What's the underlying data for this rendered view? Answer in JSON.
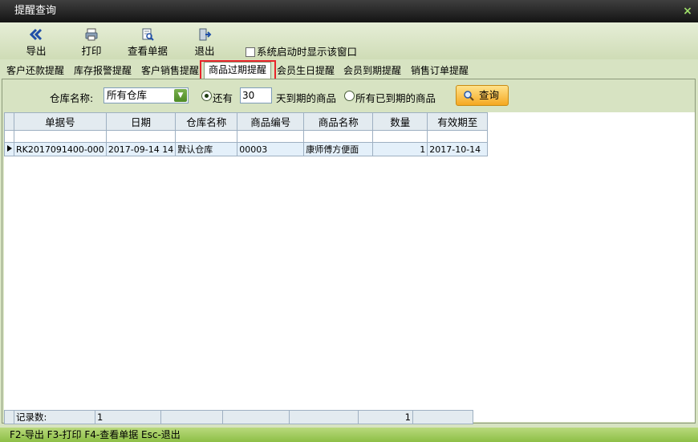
{
  "window": {
    "title": "提醒查询"
  },
  "toolbar": {
    "export": "导出",
    "print": "打印",
    "view_doc": "查看单据",
    "exit": "退出",
    "startup_checkbox": "系统启动时显示该窗口"
  },
  "tabs": [
    "客户还款提醒",
    "库存报警提醒",
    "客户销售提醒",
    "商品过期提醒",
    "会员生日提醒",
    "会员到期提醒",
    "销售订单提醒"
  ],
  "active_tab": "商品过期提醒",
  "filter": {
    "warehouse_label": "仓库名称:",
    "warehouse_value": "所有仓库",
    "radio_within": "还有",
    "days_value": "30",
    "days_suffix": "天到期的商品",
    "radio_expired": "所有已到期的商品",
    "query_button": "查询"
  },
  "table": {
    "columns": [
      "单据号",
      "日期",
      "仓库名称",
      "商品编号",
      "商品名称",
      "数量",
      "有效期至"
    ],
    "rows": [
      [
        "RK2017091400-000",
        "2017-09-14 14",
        "默认仓库",
        "00003",
        "康师傅方便面",
        "1",
        "2017-10-14"
      ]
    ],
    "footer": {
      "label": "记录数:",
      "count": "1",
      "qty_total": "1"
    }
  },
  "statusbar": "F2-导出 F3-打印 F4-查看单据 Esc-退出",
  "colors": {
    "accent_green": "#8dbf46",
    "highlight": "#e8242a",
    "query_button": "#f5a822"
  }
}
